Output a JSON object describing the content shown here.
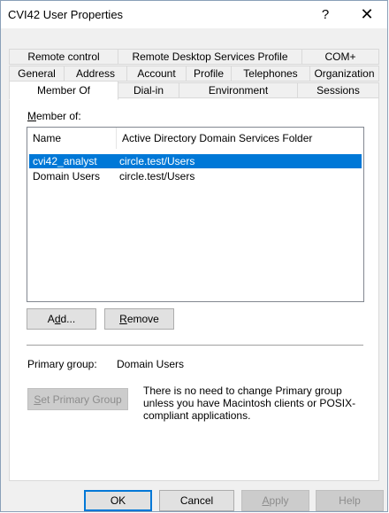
{
  "window": {
    "title": "CVI42 User Properties",
    "help_glyph": "?",
    "close_glyph": "✕"
  },
  "tabs": {
    "row1": [
      "Remote control",
      "Remote Desktop Services Profile",
      "COM+"
    ],
    "row2": [
      "General",
      "Address",
      "Account",
      "Profile",
      "Telephones",
      "Organization"
    ],
    "row3": [
      "Member Of",
      "Dial-in",
      "Environment",
      "Sessions"
    ],
    "active": "Member Of"
  },
  "member_of": {
    "label_accel": "M",
    "label_rest": "ember of:",
    "columns": [
      "Name",
      "Active Directory Domain Services Folder"
    ],
    "rows": [
      {
        "name": "cvi42_analyst",
        "folder": "circle.test/Users",
        "selected": true
      },
      {
        "name": "Domain Users",
        "folder": "circle.test/Users",
        "selected": false
      }
    ]
  },
  "buttons": {
    "add_pre": "A",
    "add_accel": "d",
    "add_post": "d...",
    "remove_accel": "R",
    "remove_rest": "emove",
    "set_primary_accel": "S",
    "set_primary_rest": "et Primary Group"
  },
  "primary_group": {
    "label": "Primary group:",
    "value": "Domain Users",
    "info": "There is no need to change Primary group unless you have Macintosh clients or POSIX-compliant applications."
  },
  "footer": {
    "ok": "OK",
    "cancel": "Cancel",
    "apply_accel": "A",
    "apply_rest": "pply",
    "help": "Help"
  }
}
